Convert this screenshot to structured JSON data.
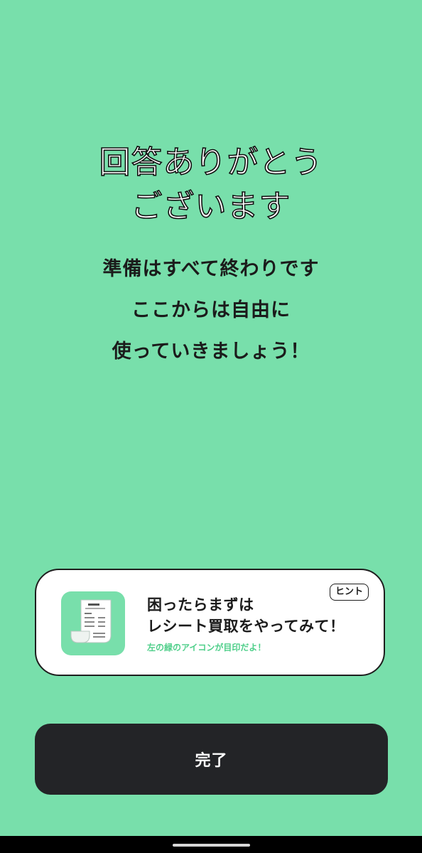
{
  "colors": {
    "background": "#78dfab",
    "button": "#232427",
    "accent_text": "#4fcf8a"
  },
  "header": {
    "title_lines": [
      "回答ありがとう",
      "ございます"
    ]
  },
  "message": {
    "lines": [
      "準備はすべて終わりです",
      "ここからは自由に",
      "使っていきましょう！"
    ]
  },
  "hint_card": {
    "badge": "ヒント",
    "icon": "receipt-icon",
    "lines": [
      "困ったらまずは",
      "レシート買取をやってみて！"
    ],
    "sub_text": "左の緑のアイコンが目印だよ！"
  },
  "done_button": {
    "label": "完了"
  }
}
